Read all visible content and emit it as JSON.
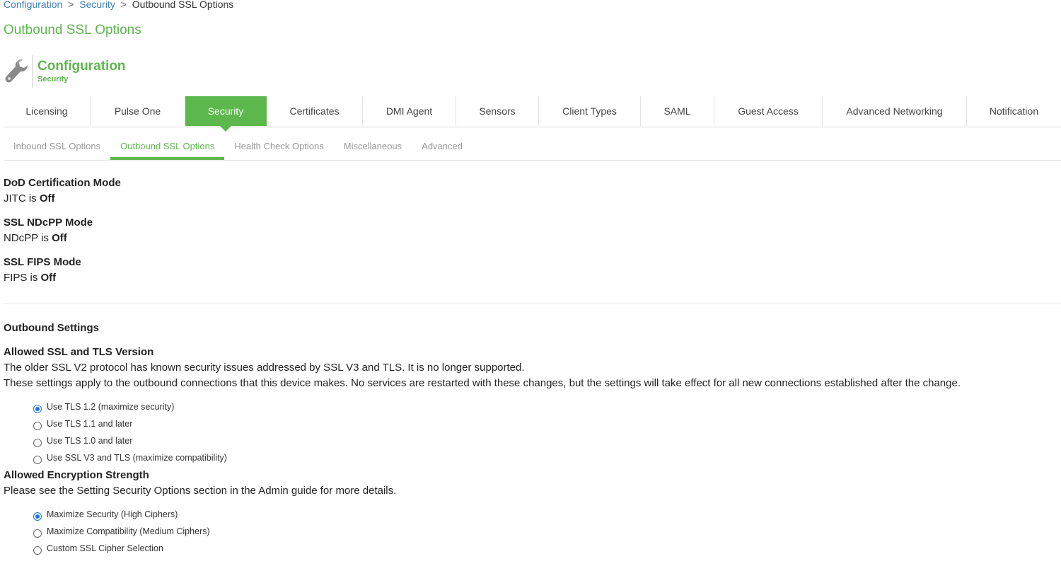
{
  "breadcrumb": {
    "item1": "Configuration",
    "sep1": ">",
    "item2": "Security",
    "sep2": ">",
    "current": "Outbound SSL Options"
  },
  "page_title": "Outbound SSL Options",
  "section": {
    "icon": "wrench-icon",
    "title": "Configuration",
    "subtitle": "Security"
  },
  "tabs": [
    {
      "label": "Licensing"
    },
    {
      "label": "Pulse One"
    },
    {
      "label": "Security",
      "active": true
    },
    {
      "label": "Certificates"
    },
    {
      "label": "DMI Agent"
    },
    {
      "label": "Sensors"
    },
    {
      "label": "Client Types"
    },
    {
      "label": "SAML"
    },
    {
      "label": "Guest Access"
    },
    {
      "label": "Advanced Networking"
    },
    {
      "label": "Notification"
    }
  ],
  "subtabs": [
    {
      "label": "Inbound SSL Options"
    },
    {
      "label": "Outbound SSL Options",
      "active": true
    },
    {
      "label": "Health Check Options"
    },
    {
      "label": "Miscellaneous"
    },
    {
      "label": "Advanced"
    }
  ],
  "modes": [
    {
      "title": "DoD Certification Mode",
      "prefix": "JITC is",
      "state": "Off"
    },
    {
      "title": "SSL NDcPP Mode",
      "prefix": "NDcPP is",
      "state": "Off"
    },
    {
      "title": "SSL FIPS Mode",
      "prefix": "FIPS is",
      "state": "Off"
    }
  ],
  "outbound": {
    "heading": "Outbound Settings",
    "tls": {
      "title": "Allowed SSL and TLS Version",
      "desc1": "The older SSL V2 protocol has known security issues addressed by SSL V3 and TLS. It is no longer supported.",
      "desc2": "These settings apply to the outbound connections that this device makes. No services are restarted with these changes, but the settings will take effect for all new connections established after the change.",
      "options": [
        {
          "label": "Use TLS 1.2 (maximize security)",
          "checked": true
        },
        {
          "label": "Use TLS 1.1 and later",
          "checked": false
        },
        {
          "label": "Use TLS 1.0 and later",
          "checked": false
        },
        {
          "label": "Use SSL V3 and TLS (maximize compatibility)",
          "checked": false
        }
      ]
    },
    "encryption": {
      "title": "Allowed Encryption Strength",
      "desc": "Please see the Setting Security Options section in the Admin guide for more details.",
      "options": [
        {
          "label": "Maximize Security (High Ciphers)",
          "checked": true
        },
        {
          "label": "Maximize Compatibility (Medium Ciphers)",
          "checked": false
        },
        {
          "label": "Custom SSL Cipher Selection",
          "checked": false
        }
      ]
    }
  },
  "colors": {
    "accent": "#5cb84d",
    "link": "#3f7fbf",
    "radio_checked": "#1a73e8"
  }
}
